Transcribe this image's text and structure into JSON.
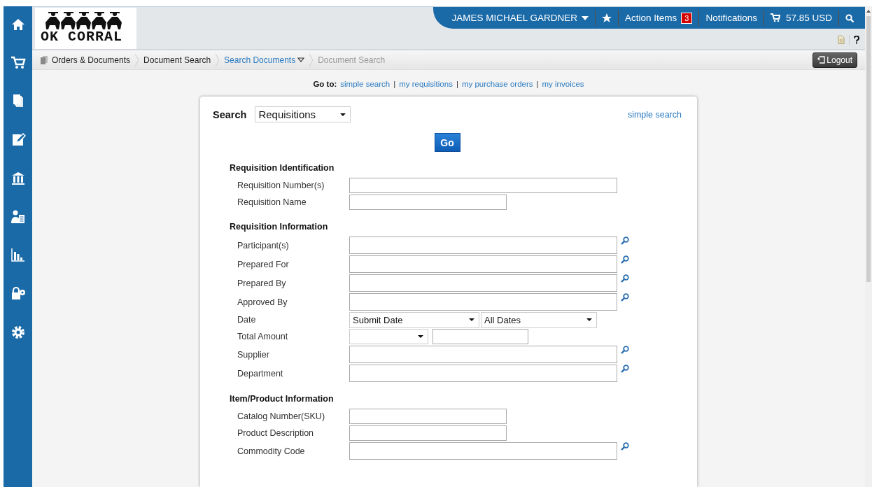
{
  "user_menu": {
    "name": "JAMES MICHAEL GARDNER",
    "action_items": "Action Items",
    "action_count": "3",
    "notifications": "Notifications",
    "cart_total": "57.85 USD"
  },
  "logo": {
    "text": "OK CORRAL"
  },
  "breadcrumb": [
    {
      "label": "Orders & Documents",
      "kind": "root"
    },
    {
      "label": "Document Search",
      "kind": "plain"
    },
    {
      "label": "Search Documents",
      "kind": "menu"
    },
    {
      "label": "Document Search",
      "kind": "current"
    }
  ],
  "logout": "Logout",
  "goto": {
    "label": "Go to:",
    "separator": "|",
    "links": [
      "simple search",
      "my requisitions",
      "my purchase orders",
      "my invoices"
    ]
  },
  "search": {
    "label": "Search",
    "type": "Requisitions",
    "simple_search": "simple search",
    "go": "Go"
  },
  "sections": [
    {
      "title": "Requisition Identification",
      "fields": [
        {
          "label": "Requisition Number(s)",
          "kind": "wide_text"
        },
        {
          "label": "Requisition Name",
          "kind": "short_text"
        }
      ]
    },
    {
      "title": "Requisition Information",
      "fields": [
        {
          "label": "Participant(s)",
          "kind": "lookup"
        },
        {
          "label": "Prepared For",
          "kind": "lookup"
        },
        {
          "label": "Prepared By",
          "kind": "lookup"
        },
        {
          "label": "Approved By",
          "kind": "lookup"
        },
        {
          "label": "Date",
          "kind": "date",
          "values": [
            "Submit Date",
            "All Dates"
          ]
        },
        {
          "label": "Total Amount",
          "kind": "amount"
        },
        {
          "label": "Supplier",
          "kind": "lookup"
        },
        {
          "label": "Department",
          "kind": "lookup"
        }
      ]
    },
    {
      "title": "Item/Product Information",
      "fields": [
        {
          "label": "Catalog Number(SKU)",
          "kind": "short_text"
        },
        {
          "label": "Product Description",
          "kind": "short_text"
        },
        {
          "label": "Commodity Code",
          "kind": "lookup"
        }
      ]
    }
  ]
}
